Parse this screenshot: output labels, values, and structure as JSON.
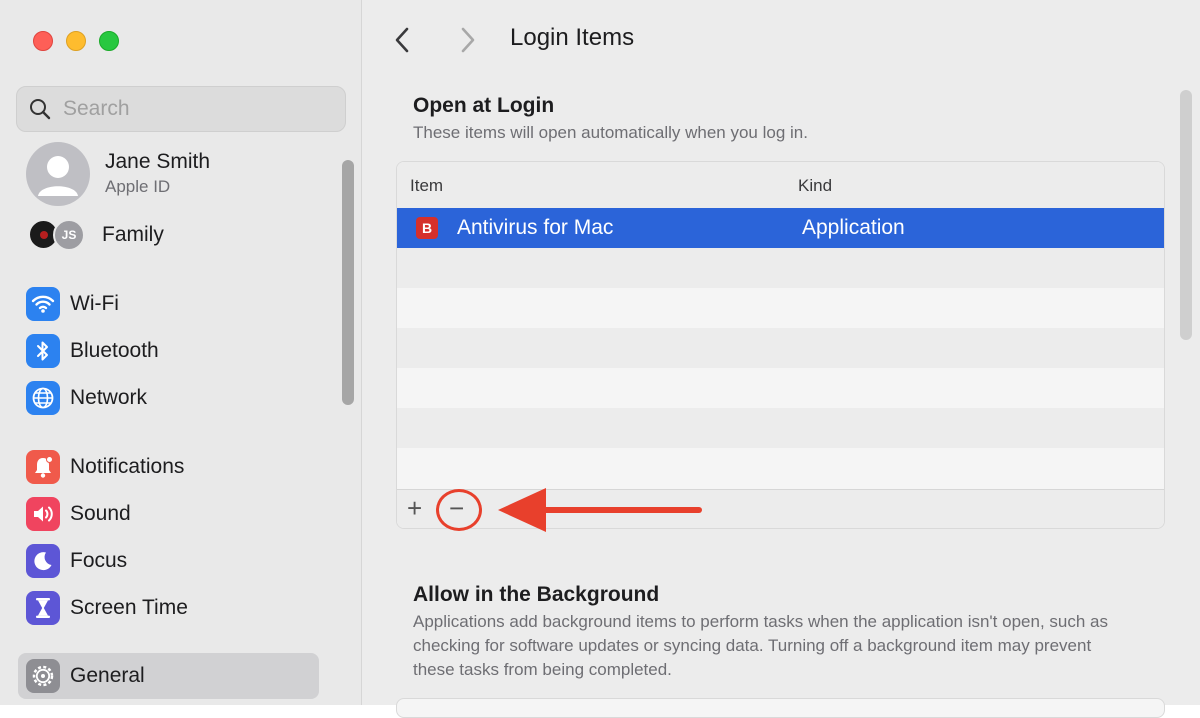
{
  "sidebar": {
    "search": {
      "placeholder": "Search"
    },
    "profile": {
      "name": "Jane Smith",
      "subtitle": "Apple ID"
    },
    "family": {
      "initials": "JS",
      "label": "Family"
    },
    "items": [
      {
        "label": "Wi-Fi",
        "icon": "wifi-icon",
        "color": "#2c82f0"
      },
      {
        "label": "Bluetooth",
        "icon": "bluetooth-icon",
        "color": "#2c82f0"
      },
      {
        "label": "Network",
        "icon": "globe-icon",
        "color": "#2c82f0"
      },
      {
        "label": "Notifications",
        "icon": "bell-icon",
        "color": "#f05a4b"
      },
      {
        "label": "Sound",
        "icon": "speaker-icon",
        "color": "#f0445f"
      },
      {
        "label": "Focus",
        "icon": "moon-icon",
        "color": "#5d56d6"
      },
      {
        "label": "Screen Time",
        "icon": "hourglass-icon",
        "color": "#5d56d6"
      },
      {
        "label": "General",
        "icon": "gear-icon",
        "color": "#8e8e93",
        "selected": true
      }
    ]
  },
  "main": {
    "title": "Login Items",
    "open_at_login": {
      "title": "Open at Login",
      "description": "These items will open automatically when you log in.",
      "columns": {
        "item": "Item",
        "kind": "Kind"
      },
      "rows": [
        {
          "badge": "B",
          "name": "Antivirus for Mac",
          "kind": "Application"
        }
      ],
      "add_label": "+",
      "remove_label": "−"
    },
    "background": {
      "title": "Allow in the Background",
      "description": "Applications add background items to perform tasks when the application isn't open, such as checking for software updates or syncing data. Turning off a background item may prevent these tasks from being completed."
    }
  },
  "colors": {
    "selection": "#2b64d9",
    "annotation": "#e8402c"
  }
}
